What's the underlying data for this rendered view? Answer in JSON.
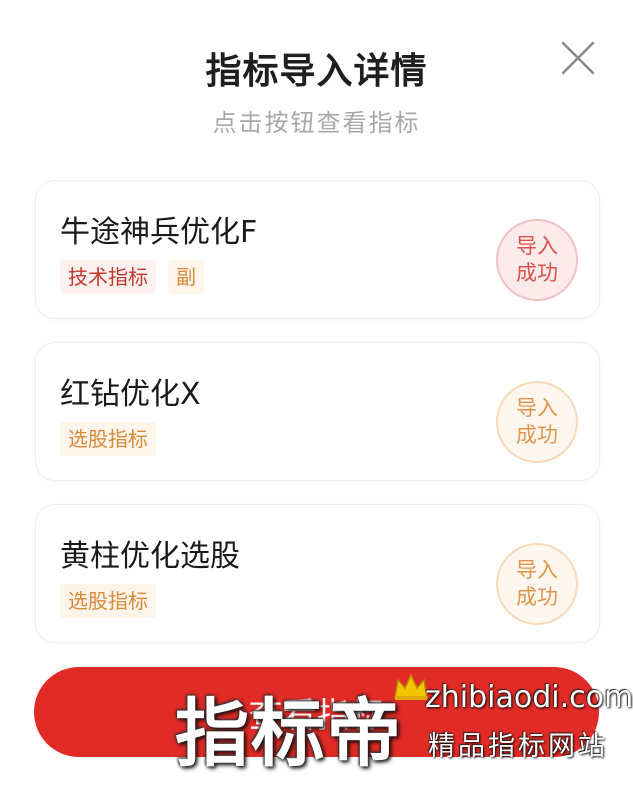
{
  "header": {
    "title": "指标导入详情",
    "subtitle": "点击按钮查看指标",
    "close_icon": "close-icon"
  },
  "colors": {
    "primary_red": "#e02b26",
    "tag_red_text": "#c0392b",
    "tag_orange_text": "#d9893a",
    "badge_red": "#d9534f",
    "badge_orange": "#e0954a"
  },
  "items": [
    {
      "name": "牛途神兵优化F",
      "tags": [
        "技术指标",
        "副"
      ],
      "status": "导入\n成功"
    },
    {
      "name": "红钻优化X",
      "tags": [
        "选股指标"
      ],
      "status": "导入\n成功"
    },
    {
      "name": "黄柱优化选股",
      "tags": [
        "选股指标"
      ],
      "status": "导入\n成功"
    }
  ],
  "cta": {
    "label": "查看指标"
  },
  "watermark": {
    "brand": "指标帝",
    "url": "zhibiaodi.com",
    "slogan": "精品指标网站"
  }
}
